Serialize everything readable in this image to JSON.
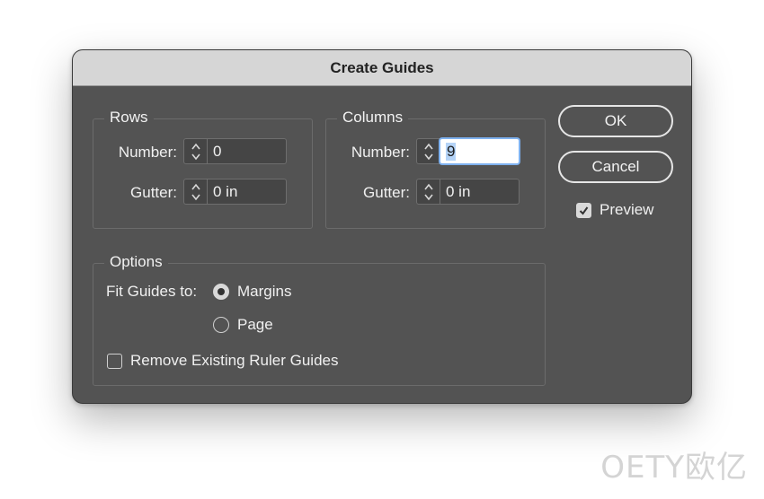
{
  "dialog": {
    "title": "Create Guides"
  },
  "rows": {
    "legend": "Rows",
    "number_label": "Number:",
    "number_value": "0",
    "gutter_label": "Gutter:",
    "gutter_value": "0 in"
  },
  "columns": {
    "legend": "Columns",
    "number_label": "Number:",
    "number_value": "9",
    "gutter_label": "Gutter:",
    "gutter_value": "0 in"
  },
  "options": {
    "legend": "Options",
    "fit_label": "Fit Guides to:",
    "radio_margins": "Margins",
    "radio_page": "Page",
    "selected": "Margins",
    "remove_label": "Remove Existing Ruler Guides",
    "remove_checked": false
  },
  "buttons": {
    "ok": "OK",
    "cancel": "Cancel"
  },
  "preview": {
    "label": "Preview",
    "checked": true
  },
  "watermark": "OETY欧亿"
}
